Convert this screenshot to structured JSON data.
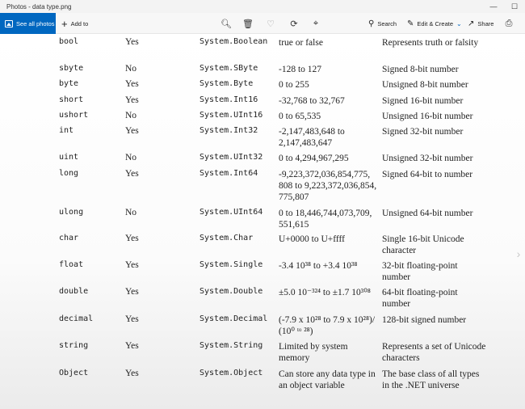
{
  "window": {
    "title": "Photos - data type.png"
  },
  "toolbar": {
    "see_all": "See all photos",
    "add_to": "Add to",
    "search": "Search",
    "edit_create": "Edit & Create",
    "share": "Share"
  },
  "table": {
    "rows": [
      {
        "keyword": "bool",
        "cls": "Yes",
        "net": "System.Boolean",
        "range": "true or false",
        "desc": "Represents truth or falsity"
      },
      {
        "keyword": "sbyte",
        "cls": "No",
        "net": "System.SByte",
        "range": "-128 to 127",
        "desc": "Signed 8-bit number"
      },
      {
        "keyword": "byte",
        "cls": "Yes",
        "net": "System.Byte",
        "range": "0 to 255",
        "desc": "Unsigned 8-bit number"
      },
      {
        "keyword": "short",
        "cls": "Yes",
        "net": "System.Int16",
        "range": "-32,768 to 32,767",
        "desc": "Signed 16-bit number"
      },
      {
        "keyword": "ushort",
        "cls": "No",
        "net": "System.UInt16",
        "range": "0 to 65,535",
        "desc": "Unsigned 16-bit number"
      },
      {
        "keyword": "int",
        "cls": "Yes",
        "net": "System.Int32",
        "range": "-2,147,483,648 to 2,147,483,647",
        "desc": "Signed 32-bit number"
      },
      {
        "keyword": "uint",
        "cls": "No",
        "net": "System.UInt32",
        "range": "0 to 4,294,967,295",
        "desc": "Unsigned 32-bit number"
      },
      {
        "keyword": "long",
        "cls": "Yes",
        "net": "System.Int64",
        "range": "-9,223,372,036,854,775, 808 to 9,223,372,036,854, 775,807",
        "desc": "Signed 64-bit to number"
      },
      {
        "keyword": "ulong",
        "cls": "No",
        "net": "System.UInt64",
        "range": "0 to 18,446,744,073,709, 551,615",
        "desc": "Unsigned 64-bit number"
      },
      {
        "keyword": "char",
        "cls": "Yes",
        "net": "System.Char",
        "range": "U+0000 to U+ffff",
        "desc": "Single 16-bit Unicode character"
      },
      {
        "keyword": "float",
        "cls": "Yes",
        "net": "System.Single",
        "range": "-3.4 10³⁸ to +3.4 10³⁸",
        "desc": "32-bit floating-point number"
      },
      {
        "keyword": "double",
        "cls": "Yes",
        "net": "System.Double",
        "range": "±5.0 10⁻³²⁴ to ±1.7 10³⁰⁸",
        "desc": "64-bit floating-point number"
      },
      {
        "keyword": "decimal",
        "cls": "Yes",
        "net": "System.Decimal",
        "range": "(-7.9 x 10²⁸ to 7.9 x 10²⁸)/ (10⁰ ᵗᵒ ²⁸)",
        "desc": "128-bit signed number"
      },
      {
        "keyword": "string",
        "cls": "Yes",
        "net": "System.String",
        "range": "Limited by system memory",
        "desc": "Represents a set of Unicode characters"
      },
      {
        "keyword": "Object",
        "cls": "Yes",
        "net": "System.Object",
        "range": "Can store any data type in an object variable",
        "desc": "The base class of all types in the .NET universe"
      }
    ]
  },
  "icons": {
    "see_all": "photos-icon",
    "add": "plus-icon",
    "zoom": "zoom-in-icon",
    "delete": "trash-icon",
    "favorite": "heart-icon",
    "rotate": "rotate-icon",
    "crop": "crop-icon",
    "search": "search-icon",
    "edit": "edit-create-icon",
    "dropdown": "chevron-down-icon",
    "share": "share-icon",
    "print": "print-icon",
    "next": "chevron-right-icon"
  },
  "colors": {
    "accent": "#0067c0"
  }
}
